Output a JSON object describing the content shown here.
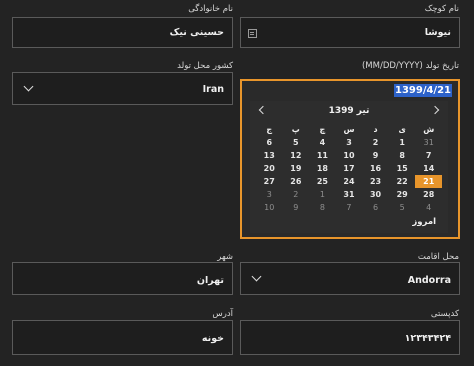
{
  "first_name": {
    "label": "نام کوچک",
    "value": "نیوشا"
  },
  "last_name": {
    "label": "نام خانوادگی",
    "value": "حسینی نیک"
  },
  "birth_date": {
    "label": "تاریخ تولد (MM/DD/YYYY)",
    "value": "1399/4/21",
    "calendar": {
      "month_title": "تیر 1399",
      "weekdays": [
        "ش",
        "ی",
        "د",
        "س",
        "چ",
        "پ",
        "ج"
      ],
      "weeks": [
        [
          "31",
          "1",
          "2",
          "3",
          "4",
          "5",
          "6"
        ],
        [
          "7",
          "8",
          "9",
          "10",
          "11",
          "12",
          "13"
        ],
        [
          "14",
          "15",
          "16",
          "17",
          "18",
          "19",
          "20"
        ],
        [
          "21",
          "22",
          "23",
          "24",
          "25",
          "26",
          "27"
        ],
        [
          "28",
          "29",
          "30",
          "31",
          "1",
          "2",
          "3"
        ],
        [
          "4",
          "5",
          "6",
          "7",
          "8",
          "9",
          "10"
        ]
      ],
      "selected_day": "21",
      "today_label": "امروز"
    }
  },
  "birth_country": {
    "label": "کشور محل تولد",
    "value": "Iran"
  },
  "residence": {
    "label": "محل اقامت",
    "value": "Andorra"
  },
  "city": {
    "label": "شهر",
    "value": "تهران"
  },
  "postal_code": {
    "label": "کدپستی",
    "value": "۱۲۳۴۳۴۲۴"
  },
  "address": {
    "label": "آدرس",
    "value": "خونه"
  },
  "colors": {
    "accent": "#e8952b",
    "selection": "#2d62c9",
    "background": "#232323"
  }
}
